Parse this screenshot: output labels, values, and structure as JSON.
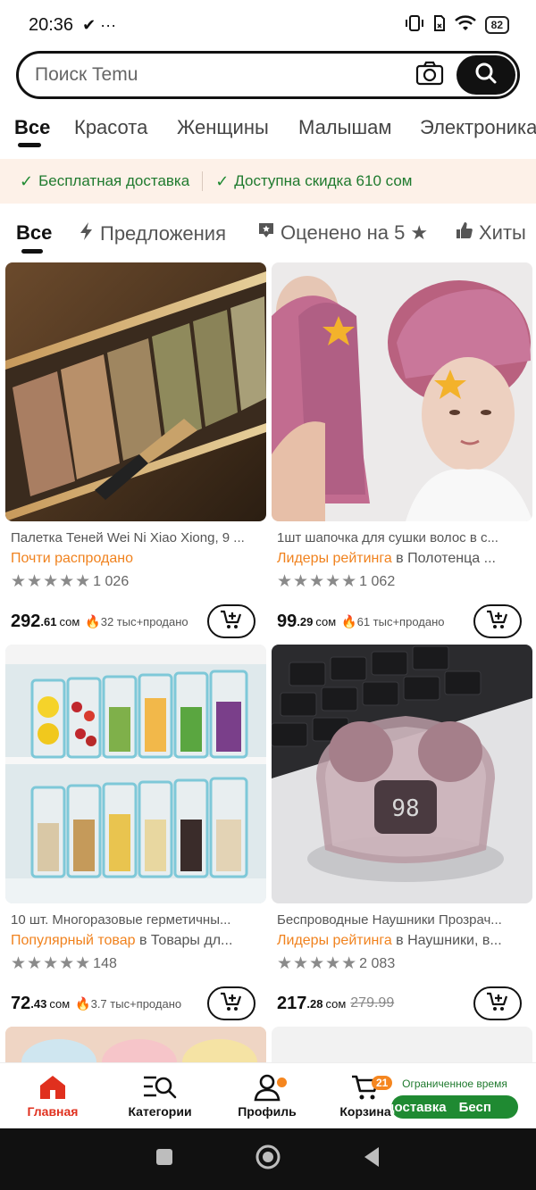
{
  "status_bar": {
    "time": "20:36",
    "extra": "✔ ···",
    "battery": "82"
  },
  "search": {
    "placeholder": "Поиск Temu"
  },
  "category_tabs": [
    "Все",
    "Красота",
    "Женщины",
    "Малышам",
    "Электроника"
  ],
  "promo": {
    "free_shipping": "Бесплатная доставка",
    "discount": "Доступна скидка 610 сом"
  },
  "filters": {
    "all": "Все",
    "offers": "Предложения",
    "rated": "Оценено на 5 ★",
    "hits": "Хиты"
  },
  "products": [
    {
      "title": "Палетка Теней Wei Ni Xiao Xiong, 9 ...",
      "tag_highlight": "Почти распродано",
      "tag_rest": "",
      "stars": "★★★★★",
      "reviews": "1 026",
      "price_main": "292",
      "price_cents": ".61",
      "currency": "сом",
      "price_old": "",
      "sold": "32 тыс+продано"
    },
    {
      "title": "1шт шапочка для сушки волос в с...",
      "tag_highlight": "Лидеры рейтинга",
      "tag_rest": " в Полотенца ...",
      "stars": "★★★★★",
      "reviews": "1 062",
      "price_main": "99",
      "price_cents": ".29",
      "currency": "сом",
      "price_old": "",
      "sold": "61 тыс+продано"
    },
    {
      "title": "10 шт. Многоразовые герметичны...",
      "tag_highlight": "Популярный товар",
      "tag_rest": " в Товары дл...",
      "stars": "★★★★★",
      "reviews": "148",
      "price_main": "72",
      "price_cents": ".43",
      "currency": "сом",
      "price_old": "",
      "sold": "3.7 тыс+продано"
    },
    {
      "title": "Беспроводные Наушники Прозрач...",
      "tag_highlight": "Лидеры рейтинга",
      "tag_rest": " в Наушники, в...",
      "stars": "★★★★★",
      "reviews": "2 083",
      "price_main": "217",
      "price_cents": ".28",
      "currency": "сом",
      "price_old": "279.99",
      "sold": ""
    }
  ],
  "bottom_nav": {
    "home": "Главная",
    "categories": "Категории",
    "profile": "Профиль",
    "cart": "Корзина",
    "cart_count": "21",
    "limited_time": "Ограниченное время",
    "pill_text_1": "доставка",
    "pill_text_2": "Бесп"
  },
  "colors": {
    "accent_orange": "#f0821e",
    "green": "#1f8a32",
    "active_red": "#e0301e"
  }
}
